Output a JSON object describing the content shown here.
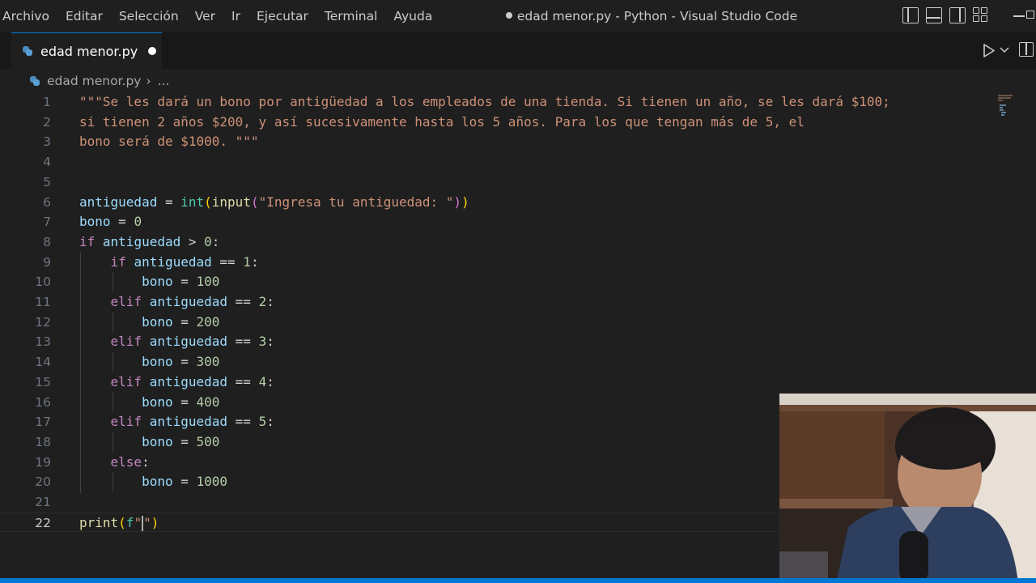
{
  "menu": [
    "Archivo",
    "Editar",
    "Selección",
    "Ver",
    "Ir",
    "Ejecutar",
    "Terminal",
    "Ayuda"
  ],
  "window_title": "edad menor.py - Python - Visual Studio Code",
  "tab": {
    "label": "edad menor.py",
    "modified": true
  },
  "breadcrumb": {
    "file": "edad menor.py",
    "more": "..."
  },
  "editor": {
    "active_line": 22,
    "lines": [
      "\"\"\"Se les dará un bono por antigüedad a los empleados de una tienda. Si tienen un año, se les dará $100;",
      "si tienen 2 años $200, y así sucesivamente hasta los 5 años. Para los que tengan más de 5, el",
      "bono será de $1000. \"\"\"",
      "",
      "",
      "antiguedad = int(input(\"Ingresa tu antiguedad: \"))",
      "bono = 0",
      "if antiguedad > 0:",
      "    if antiguedad == 1:",
      "        bono = 100",
      "    elif antiguedad == 2:",
      "        bono = 200",
      "    elif antiguedad == 3:",
      "        bono = 300",
      "    elif antiguedad == 4:",
      "        bono = 400",
      "    elif antiguedad == 5:",
      "        bono = 500",
      "    else:",
      "        bono = 1000",
      "",
      "print(f\"\")"
    ]
  },
  "colors": {
    "accent": "#0078d4",
    "string": "#ce9178",
    "keyword": "#c586c0",
    "variable": "#9cdcfe",
    "number": "#b5cea8",
    "function": "#dcdcaa",
    "builtin": "#4ec9b0"
  },
  "icons": [
    "python-file-icon",
    "run-icon",
    "chevron-down-icon",
    "split-editor-icon",
    "layout-sidebar-icon",
    "layout-panel-icon",
    "layout-secondary-icon",
    "customize-layout-icon",
    "minimize-icon",
    "restore-icon"
  ]
}
